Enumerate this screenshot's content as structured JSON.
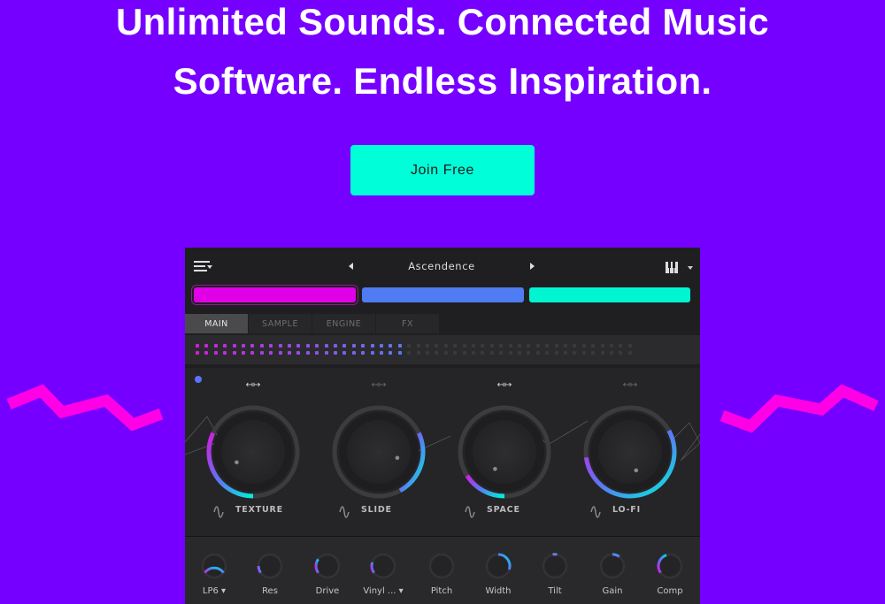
{
  "hero": {
    "headline_line1": "Unlimited Sounds. Connected Music",
    "headline_line2": "Software. Endless Inspiration.",
    "cta_label": "Join Free"
  },
  "colors": {
    "background": "#7600ff",
    "cta": "#00ffd8",
    "zigzag": "#ff00e6",
    "panel": "#1f1f21",
    "accent_magenta": "#e000e8",
    "accent_blue": "#4f7cf3",
    "accent_teal": "#00f5d0"
  },
  "plugin": {
    "preset_name": "Ascendence",
    "icons": {
      "menu": "menu-icon",
      "prev": "triangle-left-icon",
      "next": "triangle-right-icon",
      "keys": "piano-keys-icon",
      "keys_dropdown": "chevron-down-icon"
    },
    "swatches": [
      {
        "name": "magenta",
        "color": "#e000e8",
        "selected": true
      },
      {
        "name": "blue",
        "color": "#4f7cf3",
        "selected": false
      },
      {
        "name": "teal",
        "color": "#00f5d0",
        "selected": false
      }
    ],
    "tabs": [
      {
        "label": "MAIN",
        "active": true
      },
      {
        "label": "SAMPLE",
        "active": false
      },
      {
        "label": "ENGINE",
        "active": false
      },
      {
        "label": "FX",
        "active": false
      }
    ],
    "sequencer": {
      "total_steps": 48,
      "active_steps": 23
    },
    "macro_knobs": [
      {
        "label": "TEXTURE",
        "start": 0.5,
        "end": 0.82,
        "arrows_bright": true
      },
      {
        "label": "SLIDE",
        "start": 0.18,
        "end": 0.42,
        "arrows_bright": false
      },
      {
        "label": "SPACE",
        "start": 0.5,
        "end": 0.66,
        "arrows_bright": true
      },
      {
        "label": "LO-FI",
        "start": 0.17,
        "end": 0.73,
        "arrows_bright": false
      }
    ],
    "small_knobs": [
      {
        "label": "LP6",
        "dropdown": true,
        "start": 0.15,
        "end": 0.85
      },
      {
        "label": "Res",
        "dropdown": false,
        "start": 0.15,
        "end": 0.25
      },
      {
        "label": "Drive",
        "dropdown": false,
        "start": 0.15,
        "end": 0.35
      },
      {
        "label": "Vinyl ...",
        "dropdown": true,
        "start": 0.15,
        "end": 0.3
      },
      {
        "label": "Pitch",
        "dropdown": false,
        "start": 0.5,
        "end": 0.5
      },
      {
        "label": "Width",
        "dropdown": false,
        "start": 0.5,
        "end": 0.8
      },
      {
        "label": "Tilt",
        "dropdown": false,
        "start": 0.47,
        "end": 0.53
      },
      {
        "label": "Gain",
        "dropdown": false,
        "start": 0.5,
        "end": 0.6
      },
      {
        "label": "Comp",
        "dropdown": false,
        "start": 0.15,
        "end": 0.45
      }
    ]
  }
}
